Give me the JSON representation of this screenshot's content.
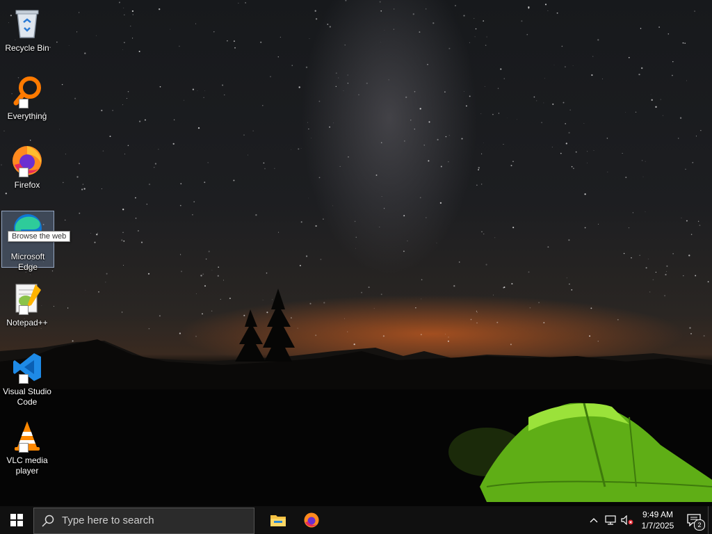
{
  "desktop": {
    "icons": [
      {
        "label": "Recycle Bin",
        "icon": "recycle-bin-icon"
      },
      {
        "label": "Everything",
        "icon": "everything-search-icon"
      },
      {
        "label": "Firefox",
        "icon": "firefox-icon"
      },
      {
        "label": "Microsoft Edge",
        "icon": "edge-icon",
        "selected": true
      },
      {
        "label": "Notepad++",
        "icon": "notepadpp-icon"
      },
      {
        "label": "Visual Studio Code",
        "icon": "vscode-icon"
      },
      {
        "label": "VLC media player",
        "icon": "vlc-icon"
      }
    ],
    "tooltip": "Browse the web"
  },
  "taskbar": {
    "search_placeholder": "Type here to search",
    "pinned": [
      {
        "name": "File Explorer",
        "icon": "file-explorer-icon"
      },
      {
        "name": "Firefox",
        "icon": "firefox-icon"
      }
    ],
    "clock": {
      "time": "9:49 AM",
      "date": "1/7/2025"
    },
    "notification_count": "2"
  },
  "colors": {
    "taskbar": "#101010",
    "search_box": "#2b2b2b",
    "tent": "#7ed321",
    "horizon_glow": "#ff6e1e"
  }
}
